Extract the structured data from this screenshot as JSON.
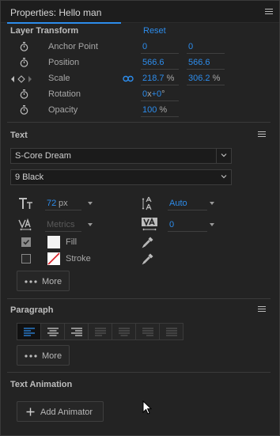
{
  "title": "Properties: Hello man",
  "layer_transform": {
    "heading": "Layer Transform",
    "reset": "Reset",
    "rows": [
      {
        "label": "Anchor Point",
        "v1": "0",
        "v2": "0"
      },
      {
        "label": "Position",
        "v1": "566.6",
        "v2": "566.6"
      },
      {
        "label": "Scale",
        "v1": "218.7",
        "u1": "%",
        "v2": "306.2",
        "u2": "%"
      },
      {
        "label": "Rotation",
        "v1": "0",
        "u1a": "x",
        "v1b": "+0",
        "u1b": "°"
      },
      {
        "label": "Opacity",
        "v1": "100",
        "u1": "%"
      }
    ]
  },
  "text": {
    "heading": "Text",
    "font_family": "S-Core Dream",
    "font_style": "9 Black",
    "font_size": "72",
    "font_size_unit": "px",
    "leading": "Auto",
    "kerning": "Metrics",
    "tracking": "0",
    "fill_label": "Fill",
    "stroke_label": "Stroke",
    "more_label": "More",
    "fill_color": "#f2f2f2",
    "stroke_color": "none"
  },
  "paragraph": {
    "heading": "Paragraph",
    "more_label": "More",
    "align_buttons": [
      "align-left",
      "align-center",
      "align-right",
      "justify-last-left",
      "justify-last-center",
      "justify-last-right",
      "justify-all"
    ]
  },
  "text_animation": {
    "heading": "Text Animation",
    "add_animator_label": "Add Animator"
  },
  "colors": {
    "accent": "#2d8ceb",
    "background": "#232323"
  }
}
